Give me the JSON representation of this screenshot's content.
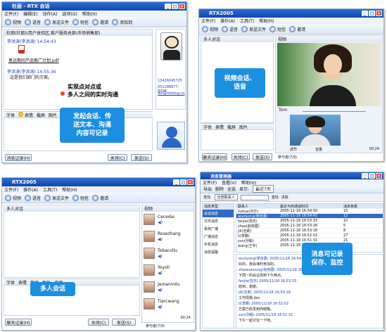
{
  "colors": {
    "title": "#1146a8",
    "bubble": "#1d8fe0",
    "callout_blue": "#1a3fb0"
  },
  "p1": {
    "title": "杜丽 - RTX 会话",
    "menu": [
      "文件(F)",
      "编辑(E)",
      "动作(A)",
      "选项(O)",
      "帮助(H)"
    ],
    "toolbar": [
      "视频",
      "语音",
      "发送文件",
      "短信",
      "邀请",
      "添加到"
    ],
    "header": "杜丽(杜丽)(用户体验区,客户服务总部\\市场销售部)",
    "msg1_sender": "李洪涛(李洪涛) 14:54:43",
    "file_name": "奥运期间产品推广计划.pdf",
    "msg2_sender": "李洪涛(李洪涛) 14:55:36",
    "msg2_text": "这是我们部门的方案。",
    "contact_phone": "13426045725",
    "contact_phone2": "051166677-8208",
    "contact_email": "dul@rtxtong.cn",
    "callout": "实现点对点或\n多人之间的实时沟通",
    "format": [
      "字体",
      "表情",
      "截屏",
      "图片"
    ],
    "bubble": "发起会话、传\n送文本、沟通\n内容可记录",
    "history_btn": "消息记录(H)",
    "close_btn": "关闭(C)",
    "send_btn": "发送(S)"
  },
  "p2": {
    "title": "RTX2005",
    "menu": [
      "文件(F)",
      "操作(A)",
      "工具(T)",
      "帮助(H)"
    ],
    "toolbar": [
      "视频",
      "语音",
      "发送文件",
      "短信",
      "邀请"
    ],
    "left_header": "多人对话",
    "right_header": "视频",
    "video_name": "Tom",
    "bubble": "视频会话、\n语音",
    "format": [
      "字体",
      "表情",
      "截屏",
      "图片"
    ],
    "history_btn": "聊天记录(H)",
    "close_btn": "关闭(C)",
    "send_btn": "发送(S)",
    "controls": [
      "调节",
      "音量"
    ],
    "participants_label": "参与者(7/9)",
    "time": "00:24"
  },
  "p3": {
    "title": "RTX2005",
    "menu": [
      "文件(F)",
      "操作(A)",
      "工具(T)",
      "帮助(H)"
    ],
    "toolbar": [
      "视频",
      "语音",
      "发送文件",
      "短信",
      "邀请"
    ],
    "left_header": "多人对话",
    "right_header": "视频",
    "members": [
      "Cecedai",
      "Rosezhang",
      "Tobacollu",
      "Yoyoli",
      "Jemaninilu",
      "Tiarcwang"
    ],
    "format": [
      "字体",
      "表情",
      "截屏",
      "图片",
      "声明"
    ],
    "bubble": "多人会话",
    "history_btn": "聊天记录(H)",
    "close_btn": "关闭(C)",
    "send_btn": "发送(S)",
    "participants_label": "参与者(7/9)",
    "time": "00:24"
  },
  "p4": {
    "title": "消息管理器",
    "menu": [
      "文件(F)",
      "查看(V)",
      "帮助(H)"
    ],
    "toolbar": [
      "导出",
      "删除",
      "全选",
      "显示:",
      "最近7天"
    ],
    "search_label": "查找:",
    "search_value": "全部联系人",
    "search_btn": "查找",
    "clear_btn": "清除",
    "tree_header": "消息类型",
    "tree": [
      "会话消息",
      "文件消息",
      "系统广播",
      "广播消息",
      "手机消息",
      "消息提醒"
    ],
    "columns": [
      "联系人",
      "最近与你通话时间",
      "消息条数"
    ],
    "rows": [
      [
        "liuhua(刘华)",
        "2005-11-18 16:54:50",
        "15"
      ],
      [
        "wuziyong(吴自勇)",
        "2005-11-18 16:54:43",
        "12"
      ],
      [
        "fanjie(范杰)",
        "2005-11-18 16:53:33",
        "10"
      ],
      [
        "zhao(赵晓蓉)",
        "2005-11-18 16:53:26",
        "5"
      ],
      [
        "jili(吉莉)",
        "2005-11-18 16:53:18",
        "8"
      ],
      [
        "li(李娜)",
        "2005-11-18 16:52:02",
        "27"
      ],
      [
        "sun(孙毅)",
        "2005-11-18 16:51:31",
        "21"
      ],
      [
        "wang(王中)",
        "2005-11-18 16:51:00",
        "30"
      ]
    ],
    "log_lines": [
      "wuziyong(吴自勇) 2005/11/18 16:54:43",
      "好的，我会准时参加的。",
      "zhaoxiaorong(赵晓蓉) 2005/11/18 16:53:26",
      "下周一的会议改到下午两点。",
      "fanjie(范杰) 2005/11/18 16:53:33",
      "收到，谢谢。",
      "jili(吉莉) 2005/11/18 16:53:18",
      "工作周报.doc",
      "li(李娜) 2005/11/18 16:52:02",
      "方案已经发到你邮箱。",
      "sun(孙毅) 2005/11/18 16:51:31",
      "下午一起讨论一下吧。"
    ],
    "bubble": "消息可记录\n保存、监控"
  }
}
